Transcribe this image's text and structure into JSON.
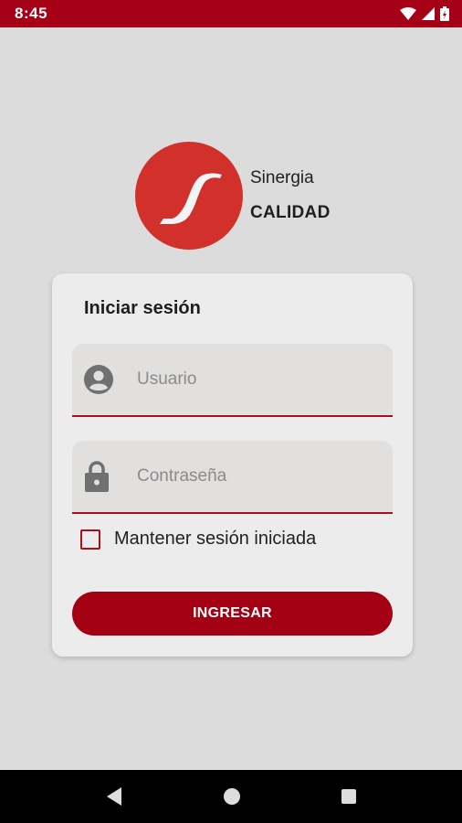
{
  "status_bar": {
    "time": "8:45",
    "icons": [
      "wifi-icon",
      "signal-icon",
      "battery-icon"
    ],
    "color": "#a50016"
  },
  "brand": {
    "line1": "Sinergia",
    "line2": "CALIDAD",
    "logo_color": "#d2302a"
  },
  "login": {
    "title": "Iniciar sesión",
    "username_placeholder": "Usuario",
    "password_placeholder": "Contraseña",
    "remember_label": "Mantener sesión iniciada",
    "remember_checked": false,
    "submit_label": "INGRESAR",
    "accent_color": "#a30014"
  },
  "nav": {
    "buttons": [
      "back-icon",
      "home-icon",
      "recents-icon"
    ]
  }
}
